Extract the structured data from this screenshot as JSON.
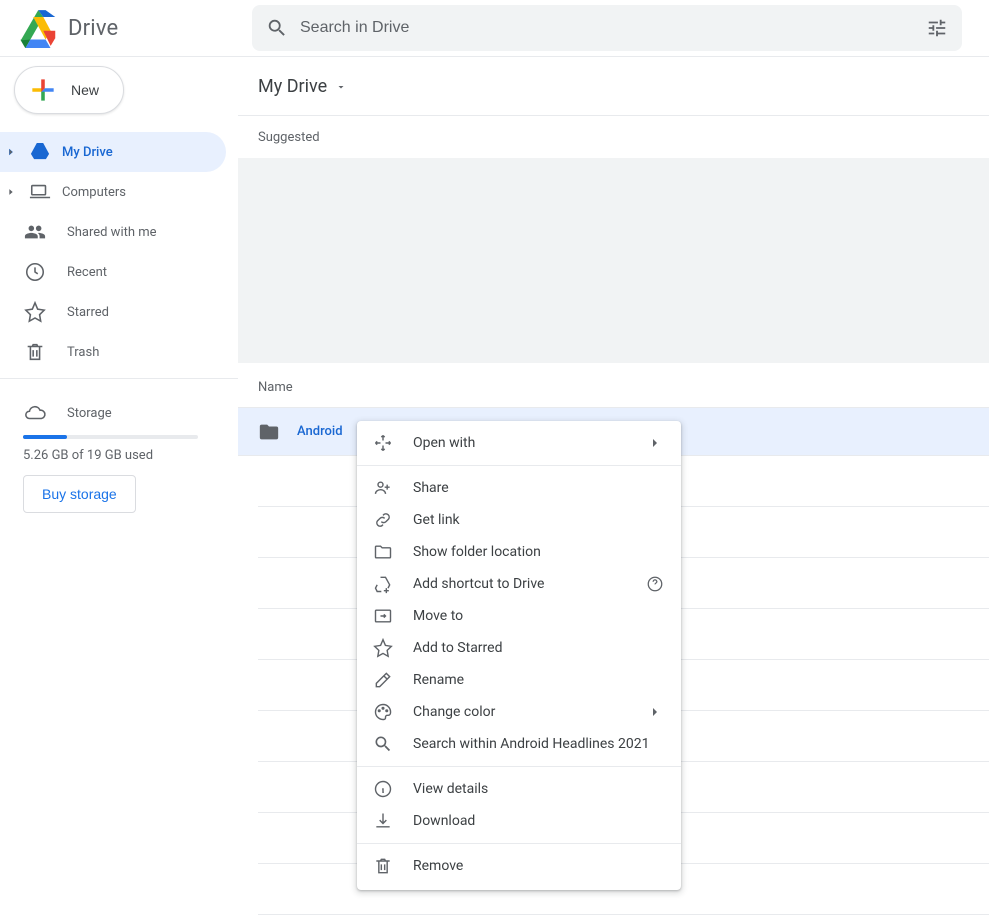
{
  "app": {
    "title": "Drive"
  },
  "search": {
    "placeholder": "Search in Drive"
  },
  "sidebar": {
    "new_label": "New",
    "items": {
      "mydrive": "My Drive",
      "computers": "Computers",
      "shared": "Shared with me",
      "recent": "Recent",
      "starred": "Starred",
      "trash": "Trash",
      "storage": "Storage"
    },
    "storage": {
      "used_text": "5.26 GB of 19 GB used",
      "buy_label": "Buy storage"
    }
  },
  "breadcrumb": {
    "title": "My Drive"
  },
  "sections": {
    "suggested": "Suggested",
    "name": "Name"
  },
  "files": {
    "selected_name": "Android"
  },
  "context_menu": {
    "open_with": "Open with",
    "share": "Share",
    "get_link": "Get link",
    "show_folder": "Show folder location",
    "add_shortcut": "Add shortcut to Drive",
    "move_to": "Move to",
    "add_starred": "Add to Starred",
    "rename": "Rename",
    "change_color": "Change color",
    "search_within": "Search within Android Headlines 2021",
    "view_details": "View details",
    "download": "Download",
    "remove": "Remove"
  }
}
